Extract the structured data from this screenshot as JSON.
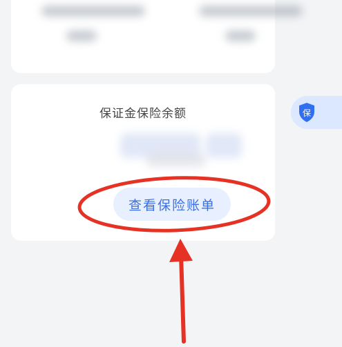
{
  "insurance": {
    "title": "保证金保险余额",
    "badge_icon": "shield-icon",
    "badge_text": "保",
    "view_bill_button": "查看保险账单"
  },
  "colors": {
    "accent": "#3d6fe0",
    "button_bg": "#e8f0ff",
    "annotation_red": "#e53225"
  }
}
